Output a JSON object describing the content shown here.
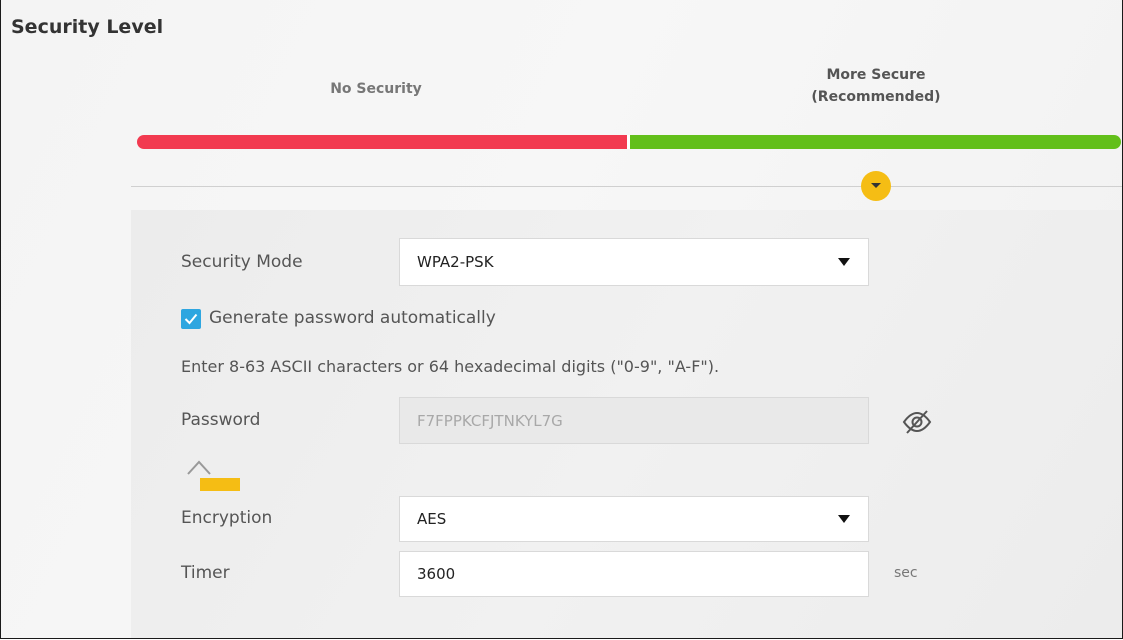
{
  "page": {
    "title": "Security Level"
  },
  "security_level": {
    "left_label": "No Security",
    "right_label_line1": "More Secure",
    "right_label_line2": "(Recommended)",
    "selected_level": "More Secure (Recommended)",
    "colors": {
      "no_security": "#f23a50",
      "more_secure": "#62bf1a",
      "slider_knob": "#f5bd14"
    }
  },
  "form": {
    "security_mode": {
      "label": "Security Mode",
      "value": "WPA2-PSK"
    },
    "generate_password": {
      "label": "Generate password automatically",
      "checked": true
    },
    "hint": "Enter 8-63 ASCII characters or 64 hexadecimal digits (\"0-9\", \"A-F\").",
    "password": {
      "label": "Password",
      "value": "F7FPPKCFJTNKYL7G",
      "disabled": true
    },
    "encryption": {
      "label": "Encryption",
      "value": "AES"
    },
    "timer": {
      "label": "Timer",
      "value": "3600",
      "unit": "sec"
    }
  },
  "icons": {
    "knob": "chevron-down-icon",
    "password_visibility": "eye-slash-icon",
    "strength": "password-strength-icon",
    "checkbox": "checkmark-icon"
  }
}
